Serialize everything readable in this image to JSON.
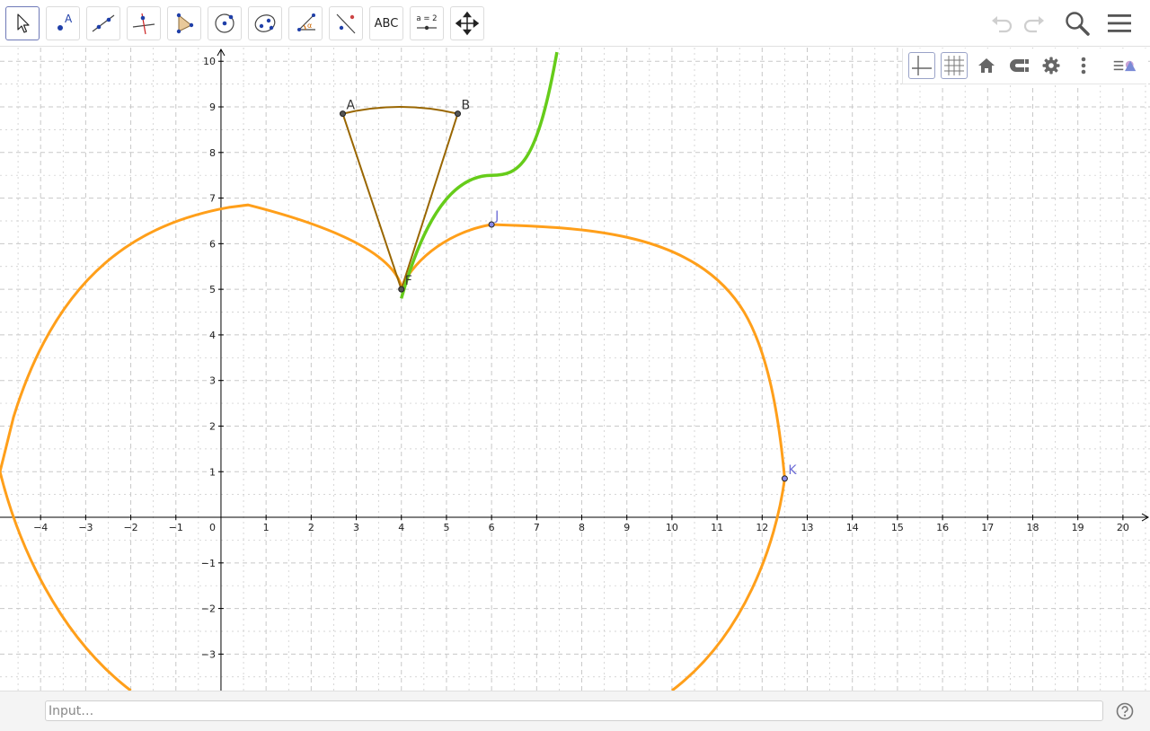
{
  "toolbar": {
    "tools": [
      {
        "name": "move-tool",
        "icon": "arrow-cursor-icon",
        "active": true
      },
      {
        "name": "point-tool",
        "icon": "point-icon",
        "label": "A"
      },
      {
        "name": "line-tool",
        "icon": "line-through-points-icon"
      },
      {
        "name": "perpendicular-line-tool",
        "icon": "perpendicular-line-icon"
      },
      {
        "name": "polygon-tool",
        "icon": "polygon-icon"
      },
      {
        "name": "circle-tool",
        "icon": "circle-center-point-icon"
      },
      {
        "name": "ellipse-tool",
        "icon": "ellipse-icon"
      },
      {
        "name": "angle-tool",
        "icon": "angle-icon",
        "label": "α"
      },
      {
        "name": "reflect-tool",
        "icon": "reflect-about-line-icon"
      },
      {
        "name": "text-tool",
        "icon": "text-icon",
        "label": "ABC"
      },
      {
        "name": "slider-tool",
        "icon": "slider-icon",
        "label": "a = 2"
      },
      {
        "name": "move-graphics-view-tool",
        "icon": "move-arrows-icon"
      }
    ],
    "right": [
      "undo-icon",
      "redo-icon",
      "search-icon",
      "menu-icon"
    ]
  },
  "style_bar": [
    "axes-toggle-icon",
    "grid-toggle-icon",
    "home-icon",
    "point-capture-icon",
    "settings-gear-icon",
    "more-vertical-icon",
    "toggle-style-bar-icon"
  ],
  "graph": {
    "x_ticks": [
      -4,
      -3,
      -2,
      -1,
      1,
      2,
      3,
      4,
      5,
      6,
      7,
      8,
      9,
      10,
      11,
      12,
      13,
      14,
      15,
      16,
      17,
      18,
      19,
      20
    ],
    "y_ticks": [
      -3,
      -2,
      -1,
      1,
      2,
      3,
      4,
      5,
      6,
      7,
      8,
      9,
      10
    ],
    "origin_label": "0",
    "xlim": [
      -4.9,
      20.6
    ],
    "ylim": [
      -3.8,
      10.3
    ],
    "grid": true,
    "points": [
      {
        "label": "A",
        "x": 2.7,
        "y": 8.85,
        "color": "#333333"
      },
      {
        "label": "B",
        "x": 5.25,
        "y": 8.85,
        "color": "#333333"
      },
      {
        "label": "F",
        "x": 4.0,
        "y": 5.0,
        "color": "#333333"
      },
      {
        "label": "J",
        "x": 6.0,
        "y": 6.42,
        "color": "#6b6bd6"
      },
      {
        "label": "K",
        "x": 12.5,
        "y": 0.85,
        "color": "#6b6bd6"
      }
    ],
    "colors": {
      "apple": "#ff9f1a",
      "leaf": "#66cc1a",
      "sector": "#996600",
      "grid": "#c8c8c8",
      "axis": "#000000"
    }
  },
  "input": {
    "placeholder": "Input…"
  },
  "help_icon": "help-question-icon"
}
